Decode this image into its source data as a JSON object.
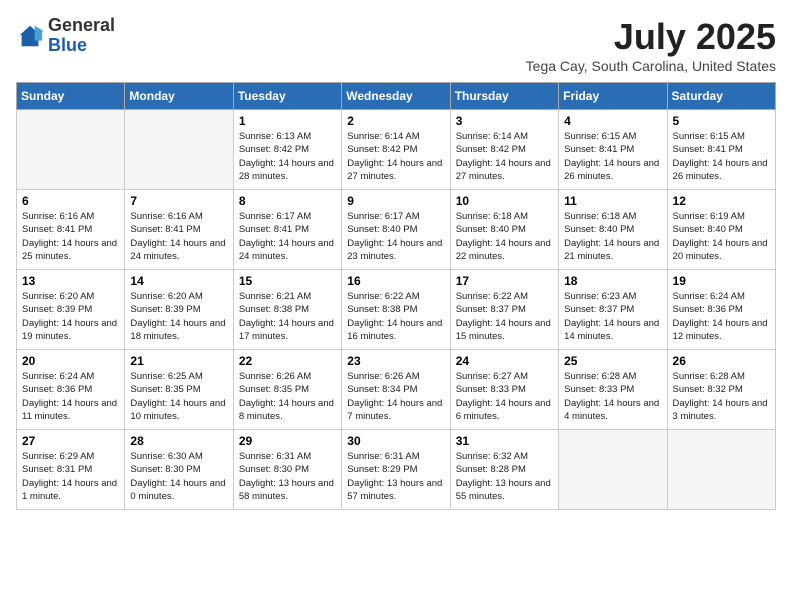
{
  "header": {
    "logo_general": "General",
    "logo_blue": "Blue",
    "month_year": "July 2025",
    "location": "Tega Cay, South Carolina, United States"
  },
  "days_of_week": [
    "Sunday",
    "Monday",
    "Tuesday",
    "Wednesday",
    "Thursday",
    "Friday",
    "Saturday"
  ],
  "weeks": [
    [
      {
        "day": "",
        "sunrise": "",
        "sunset": "",
        "daylight": "",
        "empty": true
      },
      {
        "day": "",
        "sunrise": "",
        "sunset": "",
        "daylight": "",
        "empty": true
      },
      {
        "day": "1",
        "sunrise": "Sunrise: 6:13 AM",
        "sunset": "Sunset: 8:42 PM",
        "daylight": "Daylight: 14 hours and 28 minutes.",
        "empty": false
      },
      {
        "day": "2",
        "sunrise": "Sunrise: 6:14 AM",
        "sunset": "Sunset: 8:42 PM",
        "daylight": "Daylight: 14 hours and 27 minutes.",
        "empty": false
      },
      {
        "day": "3",
        "sunrise": "Sunrise: 6:14 AM",
        "sunset": "Sunset: 8:42 PM",
        "daylight": "Daylight: 14 hours and 27 minutes.",
        "empty": false
      },
      {
        "day": "4",
        "sunrise": "Sunrise: 6:15 AM",
        "sunset": "Sunset: 8:41 PM",
        "daylight": "Daylight: 14 hours and 26 minutes.",
        "empty": false
      },
      {
        "day": "5",
        "sunrise": "Sunrise: 6:15 AM",
        "sunset": "Sunset: 8:41 PM",
        "daylight": "Daylight: 14 hours and 26 minutes.",
        "empty": false
      }
    ],
    [
      {
        "day": "6",
        "sunrise": "Sunrise: 6:16 AM",
        "sunset": "Sunset: 8:41 PM",
        "daylight": "Daylight: 14 hours and 25 minutes.",
        "empty": false
      },
      {
        "day": "7",
        "sunrise": "Sunrise: 6:16 AM",
        "sunset": "Sunset: 8:41 PM",
        "daylight": "Daylight: 14 hours and 24 minutes.",
        "empty": false
      },
      {
        "day": "8",
        "sunrise": "Sunrise: 6:17 AM",
        "sunset": "Sunset: 8:41 PM",
        "daylight": "Daylight: 14 hours and 24 minutes.",
        "empty": false
      },
      {
        "day": "9",
        "sunrise": "Sunrise: 6:17 AM",
        "sunset": "Sunset: 8:40 PM",
        "daylight": "Daylight: 14 hours and 23 minutes.",
        "empty": false
      },
      {
        "day": "10",
        "sunrise": "Sunrise: 6:18 AM",
        "sunset": "Sunset: 8:40 PM",
        "daylight": "Daylight: 14 hours and 22 minutes.",
        "empty": false
      },
      {
        "day": "11",
        "sunrise": "Sunrise: 6:18 AM",
        "sunset": "Sunset: 8:40 PM",
        "daylight": "Daylight: 14 hours and 21 minutes.",
        "empty": false
      },
      {
        "day": "12",
        "sunrise": "Sunrise: 6:19 AM",
        "sunset": "Sunset: 8:40 PM",
        "daylight": "Daylight: 14 hours and 20 minutes.",
        "empty": false
      }
    ],
    [
      {
        "day": "13",
        "sunrise": "Sunrise: 6:20 AM",
        "sunset": "Sunset: 8:39 PM",
        "daylight": "Daylight: 14 hours and 19 minutes.",
        "empty": false
      },
      {
        "day": "14",
        "sunrise": "Sunrise: 6:20 AM",
        "sunset": "Sunset: 8:39 PM",
        "daylight": "Daylight: 14 hours and 18 minutes.",
        "empty": false
      },
      {
        "day": "15",
        "sunrise": "Sunrise: 6:21 AM",
        "sunset": "Sunset: 8:38 PM",
        "daylight": "Daylight: 14 hours and 17 minutes.",
        "empty": false
      },
      {
        "day": "16",
        "sunrise": "Sunrise: 6:22 AM",
        "sunset": "Sunset: 8:38 PM",
        "daylight": "Daylight: 14 hours and 16 minutes.",
        "empty": false
      },
      {
        "day": "17",
        "sunrise": "Sunrise: 6:22 AM",
        "sunset": "Sunset: 8:37 PM",
        "daylight": "Daylight: 14 hours and 15 minutes.",
        "empty": false
      },
      {
        "day": "18",
        "sunrise": "Sunrise: 6:23 AM",
        "sunset": "Sunset: 8:37 PM",
        "daylight": "Daylight: 14 hours and 14 minutes.",
        "empty": false
      },
      {
        "day": "19",
        "sunrise": "Sunrise: 6:24 AM",
        "sunset": "Sunset: 8:36 PM",
        "daylight": "Daylight: 14 hours and 12 minutes.",
        "empty": false
      }
    ],
    [
      {
        "day": "20",
        "sunrise": "Sunrise: 6:24 AM",
        "sunset": "Sunset: 8:36 PM",
        "daylight": "Daylight: 14 hours and 11 minutes.",
        "empty": false
      },
      {
        "day": "21",
        "sunrise": "Sunrise: 6:25 AM",
        "sunset": "Sunset: 8:35 PM",
        "daylight": "Daylight: 14 hours and 10 minutes.",
        "empty": false
      },
      {
        "day": "22",
        "sunrise": "Sunrise: 6:26 AM",
        "sunset": "Sunset: 8:35 PM",
        "daylight": "Daylight: 14 hours and 8 minutes.",
        "empty": false
      },
      {
        "day": "23",
        "sunrise": "Sunrise: 6:26 AM",
        "sunset": "Sunset: 8:34 PM",
        "daylight": "Daylight: 14 hours and 7 minutes.",
        "empty": false
      },
      {
        "day": "24",
        "sunrise": "Sunrise: 6:27 AM",
        "sunset": "Sunset: 8:33 PM",
        "daylight": "Daylight: 14 hours and 6 minutes.",
        "empty": false
      },
      {
        "day": "25",
        "sunrise": "Sunrise: 6:28 AM",
        "sunset": "Sunset: 8:33 PM",
        "daylight": "Daylight: 14 hours and 4 minutes.",
        "empty": false
      },
      {
        "day": "26",
        "sunrise": "Sunrise: 6:28 AM",
        "sunset": "Sunset: 8:32 PM",
        "daylight": "Daylight: 14 hours and 3 minutes.",
        "empty": false
      }
    ],
    [
      {
        "day": "27",
        "sunrise": "Sunrise: 6:29 AM",
        "sunset": "Sunset: 8:31 PM",
        "daylight": "Daylight: 14 hours and 1 minute.",
        "empty": false
      },
      {
        "day": "28",
        "sunrise": "Sunrise: 6:30 AM",
        "sunset": "Sunset: 8:30 PM",
        "daylight": "Daylight: 14 hours and 0 minutes.",
        "empty": false
      },
      {
        "day": "29",
        "sunrise": "Sunrise: 6:31 AM",
        "sunset": "Sunset: 8:30 PM",
        "daylight": "Daylight: 13 hours and 58 minutes.",
        "empty": false
      },
      {
        "day": "30",
        "sunrise": "Sunrise: 6:31 AM",
        "sunset": "Sunset: 8:29 PM",
        "daylight": "Daylight: 13 hours and 57 minutes.",
        "empty": false
      },
      {
        "day": "31",
        "sunrise": "Sunrise: 6:32 AM",
        "sunset": "Sunset: 8:28 PM",
        "daylight": "Daylight: 13 hours and 55 minutes.",
        "empty": false
      },
      {
        "day": "",
        "sunrise": "",
        "sunset": "",
        "daylight": "",
        "empty": true
      },
      {
        "day": "",
        "sunrise": "",
        "sunset": "",
        "daylight": "",
        "empty": true
      }
    ]
  ]
}
